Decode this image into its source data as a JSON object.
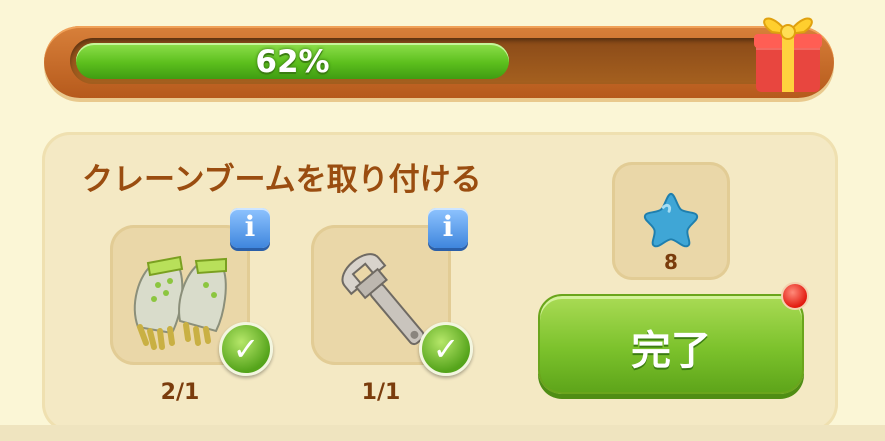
{
  "progress": {
    "percent_text": "62%",
    "fraction": 0.62,
    "gift_icon": "gift-box-icon"
  },
  "quest": {
    "title": "クレーンブームを取り付ける",
    "items": [
      {
        "icon": "gloves-icon",
        "count": "2/1",
        "completed": true,
        "info_label": "i"
      },
      {
        "icon": "wrench-icon",
        "count": "1/1",
        "completed": true,
        "info_label": "i"
      }
    ],
    "reward": {
      "icon": "blue-star-icon",
      "count": "8"
    },
    "complete_button_label": "完了",
    "check_mark": "✓"
  },
  "colors": {
    "progress_green": "#5cbf1d",
    "title_brown": "#9a4d10",
    "panel_bg": "#f4e9c4",
    "button_green": "#7cc22c",
    "notification_red": "#e21b10"
  }
}
